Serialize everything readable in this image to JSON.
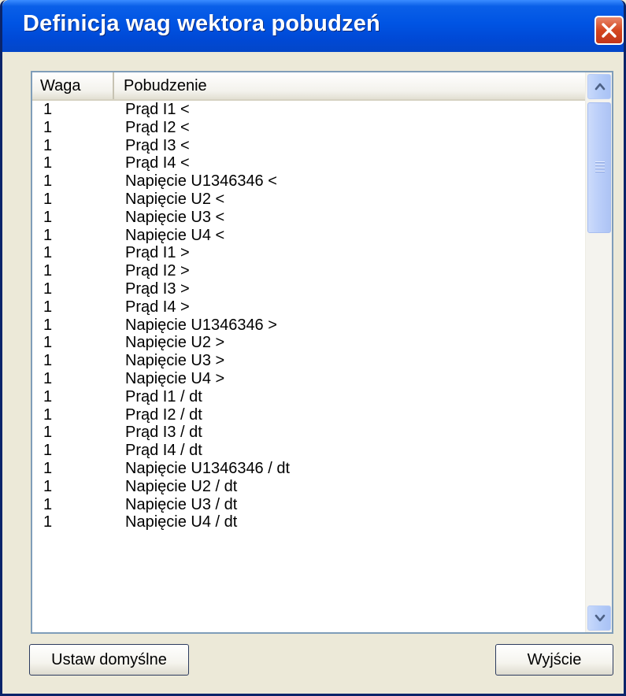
{
  "window": {
    "title": "Definicja wag wektora pobudzeń"
  },
  "table": {
    "columns": [
      "Waga",
      "Pobudzenie"
    ],
    "rows": [
      {
        "waga": "1",
        "pobudzenie": "Prąd I1 <"
      },
      {
        "waga": "1",
        "pobudzenie": "Prąd I2 <"
      },
      {
        "waga": "1",
        "pobudzenie": "Prąd I3 <"
      },
      {
        "waga": "1",
        "pobudzenie": "Prąd I4 <"
      },
      {
        "waga": "1",
        "pobudzenie": "Napięcie U1346346 <"
      },
      {
        "waga": "1",
        "pobudzenie": "Napięcie U2 <"
      },
      {
        "waga": "1",
        "pobudzenie": "Napięcie U3 <"
      },
      {
        "waga": "1",
        "pobudzenie": "Napięcie U4 <"
      },
      {
        "waga": "1",
        "pobudzenie": "Prąd I1 >"
      },
      {
        "waga": "1",
        "pobudzenie": "Prąd I2 >"
      },
      {
        "waga": "1",
        "pobudzenie": "Prąd I3 >"
      },
      {
        "waga": "1",
        "pobudzenie": "Prąd I4 >"
      },
      {
        "waga": "1",
        "pobudzenie": "Napięcie U1346346 >"
      },
      {
        "waga": "1",
        "pobudzenie": "Napięcie U2 >"
      },
      {
        "waga": "1",
        "pobudzenie": "Napięcie U3 >"
      },
      {
        "waga": "1",
        "pobudzenie": "Napięcie U4 >"
      },
      {
        "waga": "1",
        "pobudzenie": "Prąd I1 / dt"
      },
      {
        "waga": "1",
        "pobudzenie": "Prąd I2 / dt"
      },
      {
        "waga": "1",
        "pobudzenie": "Prąd I3 / dt"
      },
      {
        "waga": "1",
        "pobudzenie": "Prąd I4 / dt"
      },
      {
        "waga": "1",
        "pobudzenie": "Napięcie U1346346 / dt"
      },
      {
        "waga": "1",
        "pobudzenie": "Napięcie U2 / dt"
      },
      {
        "waga": "1",
        "pobudzenie": "Napięcie U3 / dt"
      },
      {
        "waga": "1",
        "pobudzenie": "Napięcie U4 / dt"
      }
    ]
  },
  "buttons": {
    "defaults_label": "Ustaw domyślne",
    "exit_label": "Wyjście"
  },
  "icons": {
    "close": "close-icon",
    "scroll_up": "chevron-up-icon",
    "scroll_down": "chevron-down-icon"
  },
  "colors": {
    "title_bar": "#0054E3",
    "close_button": "#D4461F",
    "dialog_background": "#ECE9D8",
    "scrollbar_accent": "#B5CCF8"
  }
}
